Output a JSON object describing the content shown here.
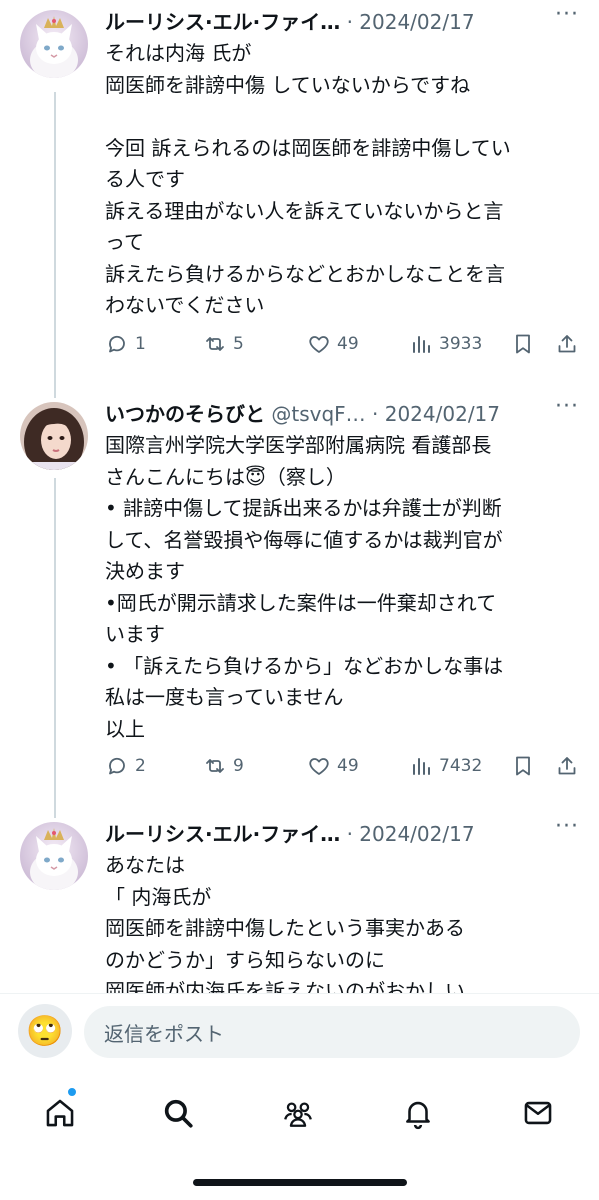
{
  "colors": {
    "text": "#0f1419",
    "secondary": "#536471",
    "thread_line": "#cfd9de",
    "accent": "#1d9bf0"
  },
  "tweets": [
    {
      "name": "ルーリシス·エル·ファイ…",
      "handle": "",
      "separator": "·",
      "date": "2024/02/17",
      "more": "···",
      "lines": [
        "それは内海 氏が",
        "岡医師を誹謗中傷 していないからですね",
        "",
        "今回 訴えられるのは岡医師を誹謗中傷してい",
        "る人です",
        "訴える理由がない人を訴えていないからと言",
        "って",
        "訴えたら負けるからなどとおかしなことを言",
        "わないでください"
      ],
      "replies": "1",
      "retweets": "5",
      "likes": "49",
      "views": "3933",
      "avatar_icon": "white-cat-crown-avatar"
    },
    {
      "name": "いつかのそらびと",
      "handle": "@tsvqF…",
      "separator": "·",
      "date": "2024/02/17",
      "more": "···",
      "lines": [
        "国際言州学院大学医学部附属病院 看護部長",
        "さんこんにちは😇（察し）",
        "• 誹謗中傷して提訴出来るかは弁護士が判断",
        "して、名誉毀損や侮辱に値するかは裁判官が",
        "決めます",
        "•岡氏が開示請求した案件は一件棄却されて",
        "います",
        "• 「訴えたら負けるから」などおかしな事は",
        "私は一度も言っていません",
        "以上"
      ],
      "replies": "2",
      "retweets": "9",
      "likes": "49",
      "views": "7432",
      "avatar_icon": "portrait-avatar"
    },
    {
      "name": "ルーリシス·エル·ファイ…",
      "handle": "",
      "separator": "·",
      "date": "2024/02/17",
      "more": "···",
      "lines": [
        "あなたは",
        "「 内海氏が",
        "岡医師を誹謗中傷したという事実かある",
        "のかどうか」すら知らないのに",
        "岡医師が内海氏を訴えないのがおかしい"
      ],
      "avatar_icon": "white-cat-crown-avatar"
    }
  ],
  "reply_bar": {
    "emoji": "🙄",
    "placeholder": "返信をポスト"
  },
  "tabbar": {
    "items": [
      "home-icon",
      "search-icon",
      "communities-icon",
      "notifications-icon",
      "messages-icon"
    ]
  }
}
